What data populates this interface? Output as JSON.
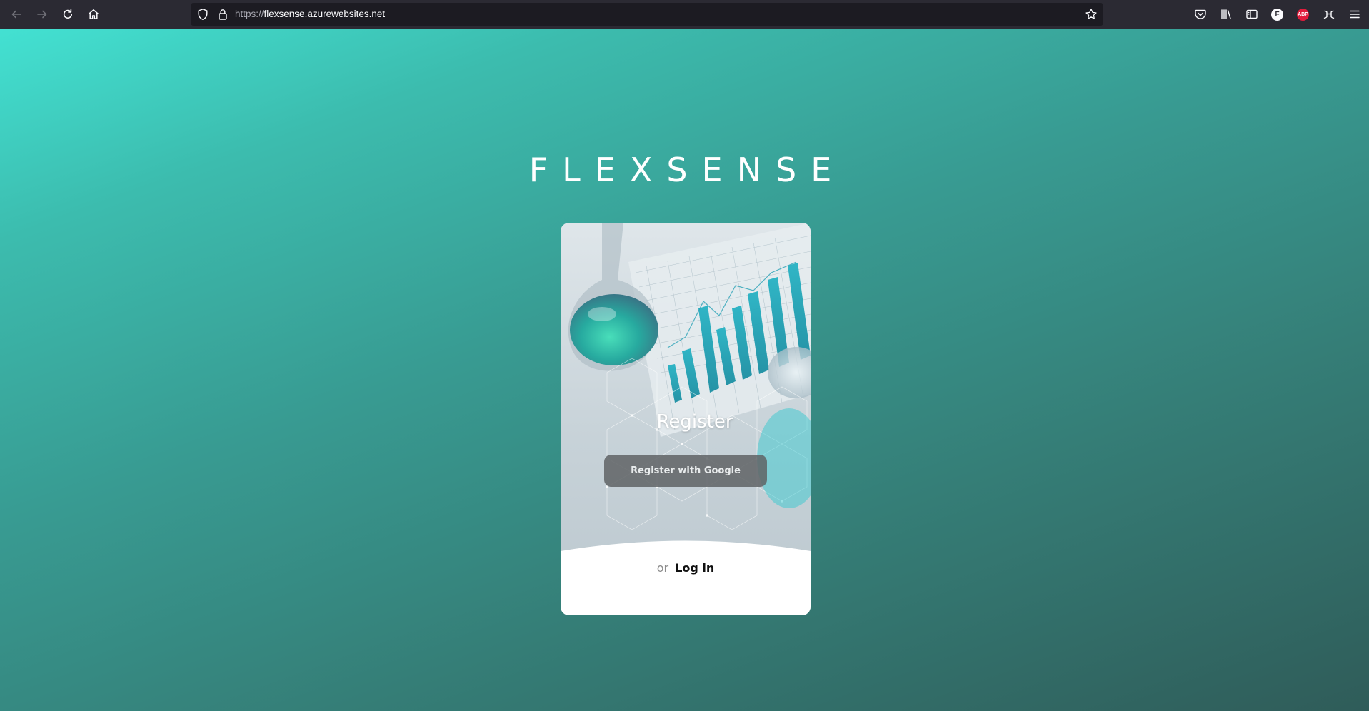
{
  "browser": {
    "url_scheme": "https://",
    "url_host": "flexsense.azurewebsites.net",
    "toolbar_icons": [
      "back-icon",
      "forward-icon",
      "reload-icon",
      "home-icon"
    ],
    "url_icons": [
      "tracking-shield-icon",
      "lock-icon",
      "bookmark-star-icon"
    ],
    "extension_icons": [
      "pocket-icon",
      "library-icon",
      "sidebar-icon",
      "ext-f-icon",
      "adblock-plus-icon",
      "reader-ext-icon",
      "menu-icon"
    ],
    "ext_f_label": "F",
    "abp_label": "ABP"
  },
  "page": {
    "brand": "FLEXSENSE",
    "card": {
      "title": "Register",
      "google_button": "Register with Google",
      "or_text": "or",
      "login_link": "Log in"
    }
  },
  "colors": {
    "gradient_start": "#43e1d2",
    "gradient_end": "#2f5c59",
    "button_bg": "#5f6365",
    "browser_bg": "#2b2a33",
    "abp_red": "#e21c3c"
  }
}
